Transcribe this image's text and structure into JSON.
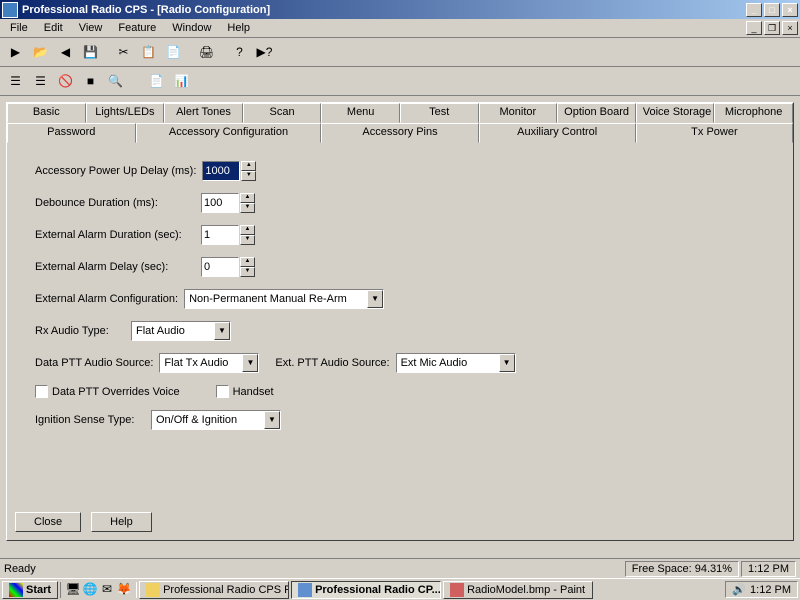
{
  "titlebar": {
    "text": "Professional Radio CPS - [Radio Configuration]"
  },
  "menu": {
    "file": "File",
    "edit": "Edit",
    "view": "View",
    "feature": "Feature",
    "window": "Window",
    "help": "Help"
  },
  "tabs": {
    "row1": [
      "Basic",
      "Lights/LEDs",
      "Alert Tones",
      "Scan",
      "Menu",
      "Test",
      "Monitor",
      "Option Board",
      "Voice Storage",
      "Microphone"
    ],
    "row2": [
      "Password",
      "Accessory Configuration",
      "Accessory Pins",
      "Auxiliary Control",
      "Tx Power"
    ]
  },
  "form": {
    "apud_label": "Accessory Power Up Delay (ms):",
    "apud_value": "1000",
    "debounce_label": "Debounce Duration (ms):",
    "debounce_value": "100",
    "ead_label": "External Alarm Duration (sec):",
    "ead_value": "1",
    "eadel_label": "External Alarm Delay (sec):",
    "eadel_value": "0",
    "eac_label": "External Alarm Configuration:",
    "eac_value": "Non-Permanent Manual Re-Arm",
    "rx_label": "Rx Audio Type:",
    "rx_value": "Flat Audio",
    "dptt_label": "Data PTT Audio Source:",
    "dptt_value": "Flat Tx Audio",
    "eptt_label": "Ext. PTT Audio Source:",
    "eptt_value": "Ext Mic Audio",
    "chk1_label": "Data PTT Overrides Voice",
    "chk2_label": "Handset",
    "ign_label": "Ignition Sense Type:",
    "ign_value": "On/Off & Ignition"
  },
  "buttons": {
    "close": "Close",
    "help": "Help"
  },
  "status": {
    "ready": "Ready",
    "free": "Free Space:  94.31%",
    "time1": "1:12 PM"
  },
  "taskbar": {
    "start": "Start",
    "t1": "Professional Radio CPS R...",
    "t2": "Professional Radio CP...",
    "t3": "RadioModel.bmp - Paint",
    "clock": "1:12 PM"
  }
}
